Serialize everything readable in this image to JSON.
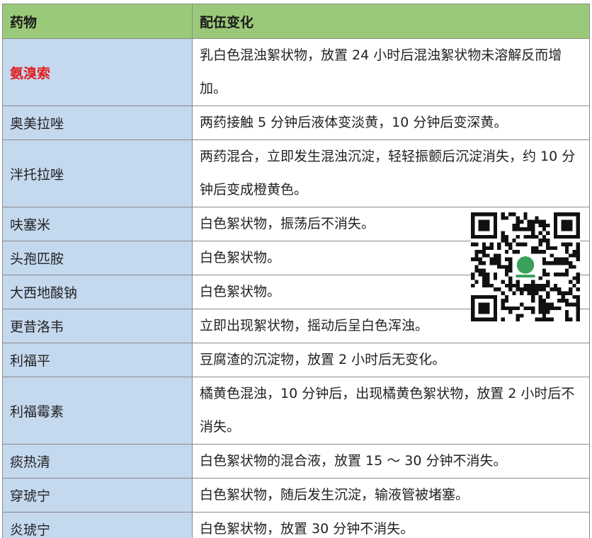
{
  "table": {
    "headers": [
      "药物",
      "配伍变化"
    ],
    "rows": [
      {
        "drug": "氨溴索",
        "change": "乳白色混浊絮状物，放置 24 小时后混浊絮状物未溶解反而增加。",
        "highlight": true
      },
      {
        "drug": "奥美拉唑",
        "change": "两药接触 5 分钟后液体变淡黄，10 分钟后变深黄。"
      },
      {
        "drug": "泮托拉唑",
        "change": "两药混合，立即发生混浊沉淀，轻轻振颤后沉淀消失，约 10 分钟后变成橙黄色。"
      },
      {
        "drug": "呋塞米",
        "change": "白色絮状物，振荡后不消失。"
      },
      {
        "drug": "头孢匹胺",
        "change": "白色絮状物。"
      },
      {
        "drug": "大西地酸钠",
        "change": "白色絮状物。"
      },
      {
        "drug": "更昔洛韦",
        "change": "立即出现絮状物，摇动后呈白色浑浊。"
      },
      {
        "drug": "利福平",
        "change": "豆腐渣的沉淀物，放置 2 小时后无变化。"
      },
      {
        "drug": "利福霉素",
        "change": "橘黄色混浊，10 分钟后，出现橘黄色絮状物，放置 2 小时后不消失。"
      },
      {
        "drug": "痰热清",
        "change": "白色絮状物的混合液，放置 15 ～ 30 分钟不消失。"
      },
      {
        "drug": "穿琥宁",
        "change": "白色絮状物，随后发生沉淀，输液管被堵塞。"
      },
      {
        "drug": "炎琥宁",
        "change": "白色絮状物，放置 30 分钟不消失。"
      }
    ]
  },
  "colors": {
    "header_bg": "#9bc97a",
    "drug_bg": "#c4d8ee",
    "highlight_text": "#e02020"
  },
  "qr_icon": "qr-code-icon"
}
